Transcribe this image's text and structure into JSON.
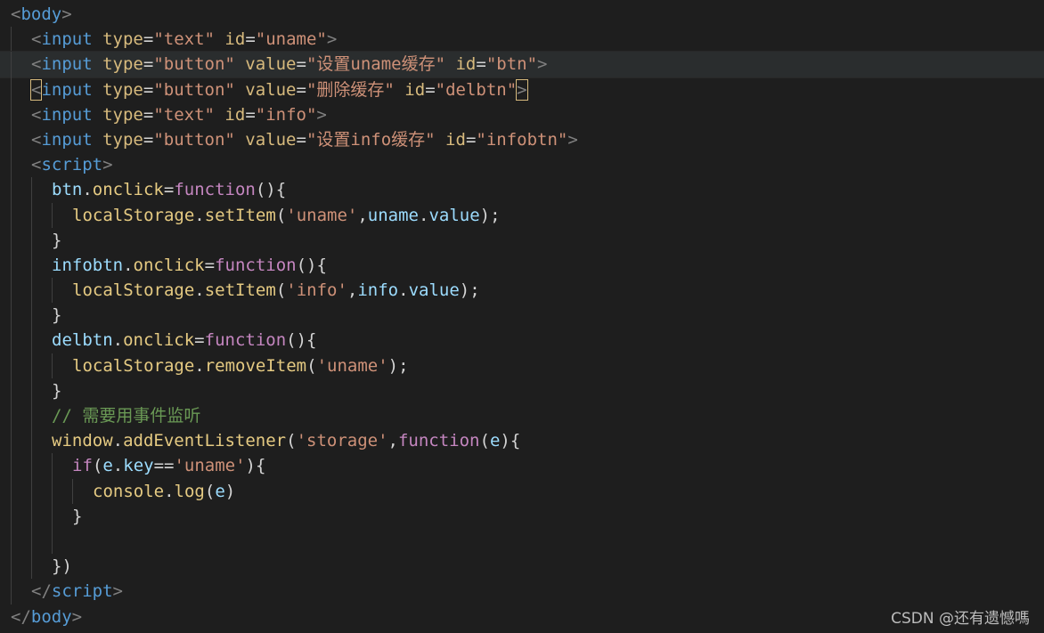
{
  "editor": {
    "language": "html",
    "current_line": 3,
    "colors": {
      "background": "#1e1e1e",
      "tag_bracket": "#808080",
      "tag_name": "#569cd6",
      "attribute": "#d7ba7d",
      "string": "#ce9178",
      "js_variable": "#9cdcfe",
      "js_property": "#e5ca82",
      "js_method": "#e5ca82",
      "js_string": "#ce9178",
      "js_keyword": "#c586c0",
      "js_punct": "#d4d4d4",
      "comment": "#6a9955",
      "current_line_bg": "#2a2d2e"
    },
    "lines": [
      {
        "indent": 0,
        "tokens": [
          {
            "t": "<",
            "c": "tag_bracket"
          },
          {
            "t": "body",
            "c": "tag_name"
          },
          {
            "t": ">",
            "c": "tag_bracket"
          }
        ]
      },
      {
        "indent": 1,
        "tokens": [
          {
            "t": "<",
            "c": "tag_bracket"
          },
          {
            "t": "input",
            "c": "tag_name"
          },
          {
            "t": " "
          },
          {
            "t": "type",
            "c": "attribute"
          },
          {
            "t": "="
          },
          {
            "t": "\"text\"",
            "c": "string"
          },
          {
            "t": " "
          },
          {
            "t": "id",
            "c": "attribute"
          },
          {
            "t": "="
          },
          {
            "t": "\"uname\"",
            "c": "string"
          },
          {
            "t": ">",
            "c": "tag_bracket"
          }
        ]
      },
      {
        "indent": 1,
        "tokens": [
          {
            "t": "<",
            "c": "tag_bracket"
          },
          {
            "t": "input",
            "c": "tag_name"
          },
          {
            "t": " "
          },
          {
            "t": "type",
            "c": "attribute"
          },
          {
            "t": "="
          },
          {
            "t": "\"button\"",
            "c": "string"
          },
          {
            "t": " "
          },
          {
            "t": "value",
            "c": "attribute"
          },
          {
            "t": "="
          },
          {
            "t": "\"设置uname缓存\"",
            "c": "string"
          },
          {
            "t": " "
          },
          {
            "t": "id",
            "c": "attribute"
          },
          {
            "t": "="
          },
          {
            "t": "\"btn\"",
            "c": "string"
          },
          {
            "t": ">",
            "c": "tag_bracket"
          }
        ]
      },
      {
        "indent": 1,
        "tokens": [
          {
            "t": "<",
            "c": "tag_bracket",
            "match": true
          },
          {
            "t": "input",
            "c": "tag_name"
          },
          {
            "t": " "
          },
          {
            "t": "type",
            "c": "attribute"
          },
          {
            "t": "="
          },
          {
            "t": "\"button\"",
            "c": "string"
          },
          {
            "t": " "
          },
          {
            "t": "value",
            "c": "attribute"
          },
          {
            "t": "="
          },
          {
            "t": "\"删除缓存\"",
            "c": "string"
          },
          {
            "t": " "
          },
          {
            "t": "id",
            "c": "attribute"
          },
          {
            "t": "="
          },
          {
            "t": "\"delbtn\"",
            "c": "string"
          },
          {
            "t": ">",
            "c": "tag_bracket",
            "match": true
          }
        ]
      },
      {
        "indent": 1,
        "tokens": [
          {
            "t": "<",
            "c": "tag_bracket"
          },
          {
            "t": "input",
            "c": "tag_name"
          },
          {
            "t": " "
          },
          {
            "t": "type",
            "c": "attribute"
          },
          {
            "t": "="
          },
          {
            "t": "\"text\"",
            "c": "string"
          },
          {
            "t": " "
          },
          {
            "t": "id",
            "c": "attribute"
          },
          {
            "t": "="
          },
          {
            "t": "\"info\"",
            "c": "string"
          },
          {
            "t": ">",
            "c": "tag_bracket"
          }
        ]
      },
      {
        "indent": 1,
        "tokens": [
          {
            "t": "<",
            "c": "tag_bracket"
          },
          {
            "t": "input",
            "c": "tag_name"
          },
          {
            "t": " "
          },
          {
            "t": "type",
            "c": "attribute"
          },
          {
            "t": "="
          },
          {
            "t": "\"button\"",
            "c": "string"
          },
          {
            "t": " "
          },
          {
            "t": "value",
            "c": "attribute"
          },
          {
            "t": "="
          },
          {
            "t": "\"设置info缓存\"",
            "c": "string"
          },
          {
            "t": " "
          },
          {
            "t": "id",
            "c": "attribute"
          },
          {
            "t": "="
          },
          {
            "t": "\"infobtn\"",
            "c": "string"
          },
          {
            "t": ">",
            "c": "tag_bracket"
          }
        ]
      },
      {
        "indent": 1,
        "tokens": [
          {
            "t": "<",
            "c": "tag_bracket"
          },
          {
            "t": "script",
            "c": "tag_name"
          },
          {
            "t": ">",
            "c": "tag_bracket"
          }
        ]
      },
      {
        "indent": 2,
        "tokens": [
          {
            "t": "btn",
            "c": "js_variable"
          },
          {
            "t": ".",
            "c": "js_punct"
          },
          {
            "t": "onclick",
            "c": "js_property"
          },
          {
            "t": "=",
            "c": "js_punct"
          },
          {
            "t": "function",
            "c": "js_keyword"
          },
          {
            "t": "(){",
            "c": "js_punct"
          }
        ]
      },
      {
        "indent": 3,
        "tokens": [
          {
            "t": "localStorage",
            "c": "js_property"
          },
          {
            "t": ".",
            "c": "js_punct"
          },
          {
            "t": "setItem",
            "c": "js_method"
          },
          {
            "t": "(",
            "c": "js_punct"
          },
          {
            "t": "'uname'",
            "c": "js_string"
          },
          {
            "t": ",",
            "c": "js_punct"
          },
          {
            "t": "uname",
            "c": "js_variable"
          },
          {
            "t": ".",
            "c": "js_punct"
          },
          {
            "t": "value",
            "c": "js_variable"
          },
          {
            "t": ");",
            "c": "js_punct"
          }
        ]
      },
      {
        "indent": 2,
        "tokens": [
          {
            "t": "}",
            "c": "js_punct"
          }
        ]
      },
      {
        "indent": 2,
        "tokens": [
          {
            "t": "infobtn",
            "c": "js_variable"
          },
          {
            "t": ".",
            "c": "js_punct"
          },
          {
            "t": "onclick",
            "c": "js_property"
          },
          {
            "t": "=",
            "c": "js_punct"
          },
          {
            "t": "function",
            "c": "js_keyword"
          },
          {
            "t": "(){",
            "c": "js_punct"
          }
        ]
      },
      {
        "indent": 3,
        "tokens": [
          {
            "t": "localStorage",
            "c": "js_property"
          },
          {
            "t": ".",
            "c": "js_punct"
          },
          {
            "t": "setItem",
            "c": "js_method"
          },
          {
            "t": "(",
            "c": "js_punct"
          },
          {
            "t": "'info'",
            "c": "js_string"
          },
          {
            "t": ",",
            "c": "js_punct"
          },
          {
            "t": "info",
            "c": "js_variable"
          },
          {
            "t": ".",
            "c": "js_punct"
          },
          {
            "t": "value",
            "c": "js_variable"
          },
          {
            "t": ");",
            "c": "js_punct"
          }
        ]
      },
      {
        "indent": 2,
        "tokens": [
          {
            "t": "}",
            "c": "js_punct"
          }
        ]
      },
      {
        "indent": 2,
        "tokens": [
          {
            "t": "delbtn",
            "c": "js_variable"
          },
          {
            "t": ".",
            "c": "js_punct"
          },
          {
            "t": "onclick",
            "c": "js_property"
          },
          {
            "t": "=",
            "c": "js_punct"
          },
          {
            "t": "function",
            "c": "js_keyword"
          },
          {
            "t": "(){",
            "c": "js_punct"
          }
        ]
      },
      {
        "indent": 3,
        "tokens": [
          {
            "t": "localStorage",
            "c": "js_property"
          },
          {
            "t": ".",
            "c": "js_punct"
          },
          {
            "t": "removeItem",
            "c": "js_method"
          },
          {
            "t": "(",
            "c": "js_punct"
          },
          {
            "t": "'uname'",
            "c": "js_string"
          },
          {
            "t": ");",
            "c": "js_punct"
          }
        ]
      },
      {
        "indent": 2,
        "tokens": [
          {
            "t": "}",
            "c": "js_punct"
          }
        ]
      },
      {
        "indent": 2,
        "tokens": [
          {
            "t": "// 需要用事件监听",
            "c": "comment"
          }
        ]
      },
      {
        "indent": 2,
        "tokens": [
          {
            "t": "window",
            "c": "js_property"
          },
          {
            "t": ".",
            "c": "js_punct"
          },
          {
            "t": "addEventListener",
            "c": "js_method"
          },
          {
            "t": "(",
            "c": "js_punct"
          },
          {
            "t": "'storage'",
            "c": "js_string"
          },
          {
            "t": ",",
            "c": "js_punct"
          },
          {
            "t": "function",
            "c": "js_keyword"
          },
          {
            "t": "(",
            "c": "js_punct"
          },
          {
            "t": "e",
            "c": "js_variable"
          },
          {
            "t": "){",
            "c": "js_punct"
          }
        ]
      },
      {
        "indent": 3,
        "tokens": [
          {
            "t": "if",
            "c": "js_keyword"
          },
          {
            "t": "(",
            "c": "js_punct"
          },
          {
            "t": "e",
            "c": "js_variable"
          },
          {
            "t": ".",
            "c": "js_punct"
          },
          {
            "t": "key",
            "c": "js_variable"
          },
          {
            "t": "==",
            "c": "js_punct"
          },
          {
            "t": "'uname'",
            "c": "js_string"
          },
          {
            "t": "){",
            "c": "js_punct"
          }
        ]
      },
      {
        "indent": 4,
        "tokens": [
          {
            "t": "console",
            "c": "js_property"
          },
          {
            "t": ".",
            "c": "js_punct"
          },
          {
            "t": "log",
            "c": "js_method"
          },
          {
            "t": "(",
            "c": "js_punct"
          },
          {
            "t": "e",
            "c": "js_variable"
          },
          {
            "t": ")",
            "c": "js_punct"
          }
        ]
      },
      {
        "indent": 3,
        "tokens": [
          {
            "t": "}",
            "c": "js_punct"
          }
        ]
      },
      {
        "indent": 3,
        "tokens": []
      },
      {
        "indent": 2,
        "tokens": [
          {
            "t": "})",
            "c": "js_punct"
          }
        ]
      },
      {
        "indent": 1,
        "tokens": [
          {
            "t": "</",
            "c": "tag_bracket"
          },
          {
            "t": "script",
            "c": "tag_name"
          },
          {
            "t": ">",
            "c": "tag_bracket"
          }
        ]
      },
      {
        "indent": 0,
        "tokens": [
          {
            "t": "</",
            "c": "tag_bracket"
          },
          {
            "t": "body",
            "c": "tag_name"
          },
          {
            "t": ">",
            "c": "tag_bracket"
          }
        ]
      }
    ]
  },
  "watermark": {
    "text": "CSDN @还有遗憾嗎"
  }
}
